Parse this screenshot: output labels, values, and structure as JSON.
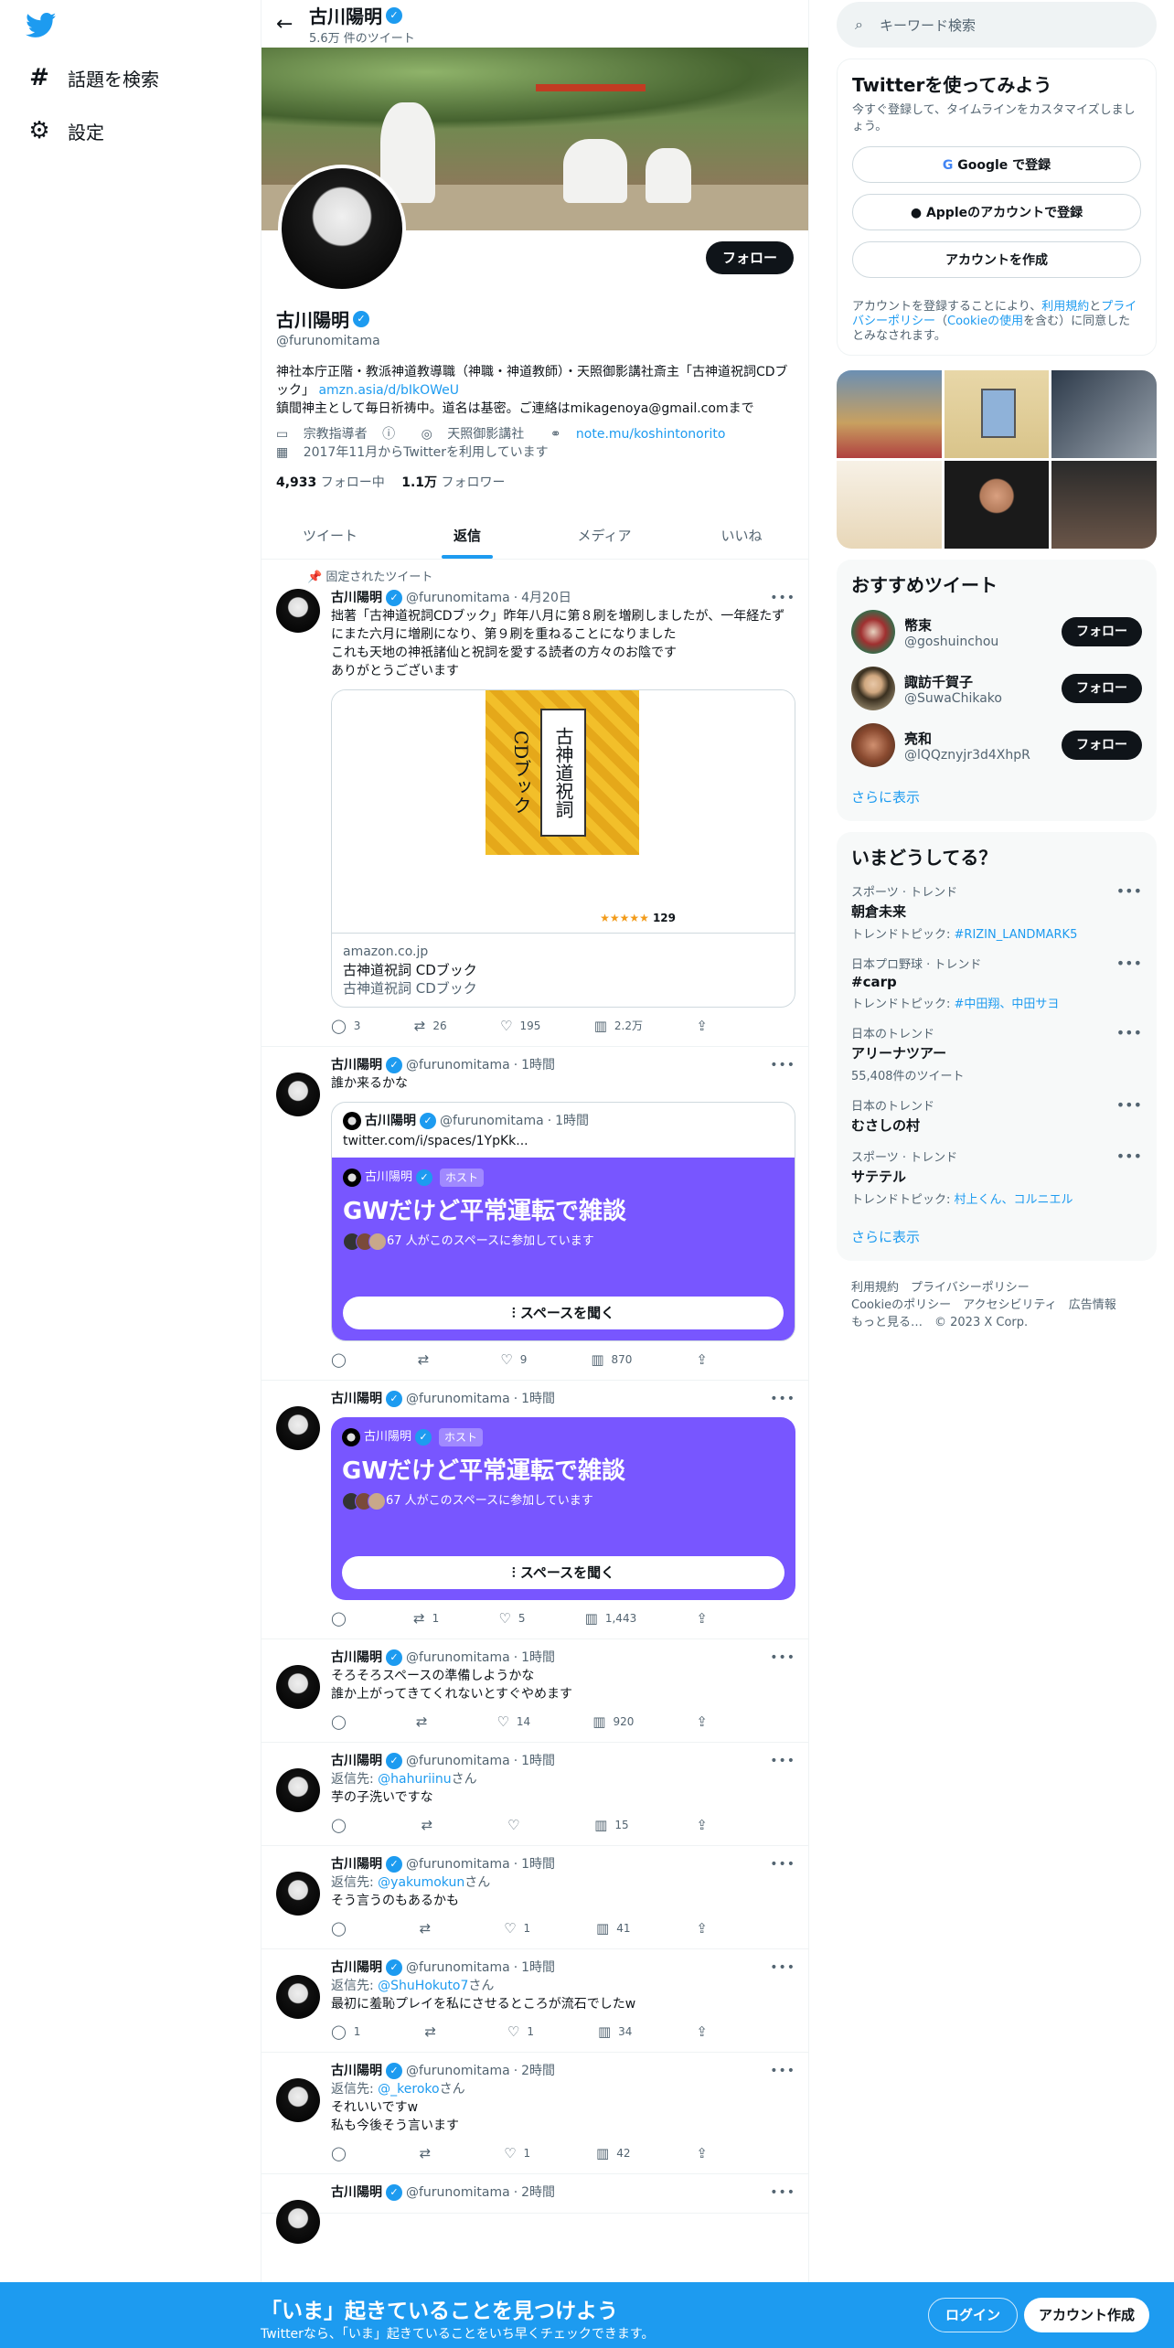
{
  "header": {
    "name": "古川陽明",
    "tweet_count": "5.6万 件のツイート"
  },
  "nav": {
    "explore": "話題を検索",
    "settings": "設定"
  },
  "profile": {
    "name": "古川陽明",
    "handle": "@furunomitama",
    "follow": "フォロー",
    "bio_line1": "神社本庁正階・教派神道教導職（神職・神道教師）・天照御影講社斎主「古神道祝詞CDブック」",
    "bio_link": "amzn.asia/d/bIkOWeU",
    "bio_line2": "鎮間神主として毎日祈祷中。道名は基密。ご連絡はmikagenoya@gmail.comまで",
    "category": "宗教指導者",
    "location": "天照御影講社",
    "website": "note.mu/koshintonorito",
    "joined": "2017年11月からTwitterを利用しています",
    "following_count": "4,933",
    "following_label": "フォロー中",
    "followers_count": "1.1万",
    "followers_label": "フォロワー"
  },
  "tabs": [
    "ツイート",
    "返信",
    "メディア",
    "いいね"
  ],
  "tweets": {
    "t1": {
      "pinned": "固定されたツイート",
      "name": "古川陽明",
      "handle": "@furunomitama",
      "time": "4月20日",
      "text": "拙著「古神道祝詞CDブック」昨年八月に第８刷を増刷しましたが、一年経たずにまた六月に増刷になり、第９刷を重ねることになりました\nこれも天地の神祇諸仙と祝詞を愛する読者の方々のお陰です\nありがとうございます",
      "book_title": "古神道祝詞 CDブック",
      "book_rating": "129",
      "card_domain": "amazon.co.jp",
      "card_title": "古神道祝詞 CDブック",
      "card_desc": "古神道祝詞 CDブック",
      "reply": "3",
      "rt": "26",
      "like": "195",
      "views": "2.2万"
    },
    "t2": {
      "name": "古川陽明",
      "handle": "@furunomitama",
      "time": "1時間",
      "text": "誰か来るかな",
      "q_name": "古川陽明",
      "q_handle": "@furunomitama",
      "q_time": "1時間",
      "q_text": "twitter.com/i/spaces/1YpKk...",
      "host_name": "古川陽明",
      "host_tag": "ホスト",
      "space_title": "GWだけど平常運転で雑談",
      "space_join": "67 人がこのスペースに参加しています",
      "space_btn": "スペースを聞く",
      "reply": "",
      "rt": "",
      "like": "9",
      "views": "870"
    },
    "t3": {
      "name": "古川陽明",
      "handle": "@furunomitama",
      "time": "1時間",
      "host_name": "古川陽明",
      "host_tag": "ホスト",
      "space_title": "GWだけど平常運転で雑談",
      "space_join": "67 人がこのスペースに参加しています",
      "space_btn": "スペースを聞く",
      "reply": "",
      "rt": "1",
      "like": "5",
      "views": "1,443"
    },
    "t4": {
      "name": "古川陽明",
      "handle": "@furunomitama",
      "time": "1時間",
      "text": "そろそろスペースの準備しようかな\n誰か上がってきてくれないとすぐやめます",
      "reply": "",
      "rt": "",
      "like": "14",
      "views": "920"
    },
    "t5": {
      "name": "古川陽明",
      "handle": "@furunomitama",
      "time": "1時間",
      "reply_to": "返信先: ",
      "reply_user": "@hahuriinu",
      "san": "さん",
      "text": "芋の子洗いですな",
      "reply": "",
      "rt": "",
      "like": "",
      "views": "15"
    },
    "t6": {
      "name": "古川陽明",
      "handle": "@furunomitama",
      "time": "1時間",
      "reply_to": "返信先: ",
      "reply_user": "@yakumokun",
      "san": "さん",
      "text": "そう言うのもあるかも",
      "reply": "",
      "rt": "",
      "like": "1",
      "views": "41"
    },
    "t7": {
      "name": "古川陽明",
      "handle": "@furunomitama",
      "time": "1時間",
      "reply_to": "返信先: ",
      "reply_user": "@ShuHokuto7",
      "san": "さん",
      "text": "最初に羞恥プレイを私にさせるところが流石でしたw",
      "reply": "1",
      "rt": "",
      "like": "1",
      "views": "34"
    },
    "t8": {
      "name": "古川陽明",
      "handle": "@furunomitama",
      "time": "2時間",
      "reply_to": "返信先: ",
      "reply_user": "@_keroko",
      "san": "さん",
      "text": "それいいですw\n私も今後そう言います",
      "reply": "",
      "rt": "",
      "like": "1",
      "views": "42"
    },
    "t9": {
      "name": "古川陽明",
      "handle": "@furunomitama",
      "time": "2時間"
    }
  },
  "right": {
    "search_placeholder": "キーワード検索",
    "signup": {
      "title": "Twitterを使ってみよう",
      "sub": "今すぐ登録して、タイムラインをカスタマイズしましょう。",
      "google": "Google で登録",
      "apple": "Appleのアカウントで登録",
      "create": "アカウントを作成",
      "legal1": "アカウントを登録することにより、",
      "terms": "利用規約",
      "and": "と",
      "privacy": "プライバシーポリシー",
      "paren": "（",
      "cookie": "Cookieの使用",
      "legal2": "を含む）に同意したとみなされます。"
    },
    "rec": {
      "title": "おすすめツイート",
      "users": [
        {
          "name": "幣束",
          "handle": "@goshuinchou",
          "btn": "フォロー"
        },
        {
          "name": "諏訪千賀子",
          "handle": "@SuwaChikako",
          "btn": "フォロー"
        },
        {
          "name": "亮和",
          "handle": "@lQQznyjr3d4XhpR",
          "btn": "フォロー"
        }
      ],
      "more": "さらに表示"
    },
    "trends": {
      "title": "いまどうしてる？",
      "items": [
        {
          "cat": "スポーツ · トレンド",
          "title": "朝倉未来",
          "sub_label": "トレンドトピック: ",
          "sub_link": "#RIZIN_LANDMARK5"
        },
        {
          "cat": "日本プロ野球 · トレンド",
          "title": "#carp",
          "sub_label": "トレンドトピック: ",
          "sub_link": "#中田翔、中田サヨ"
        },
        {
          "cat": "日本のトレンド",
          "title": "アリーナツアー",
          "sub_label": "55,408件のツイート",
          "sub_link": ""
        },
        {
          "cat": "日本のトレンド",
          "title": "むさしの村",
          "sub_label": "",
          "sub_link": ""
        },
        {
          "cat": "スポーツ · トレンド",
          "title": "サテテル",
          "sub_label": "トレンドトピック: ",
          "sub_link": "村上くん、コルニエル"
        }
      ],
      "more": "さらに表示"
    },
    "footer": {
      "l1": "利用規約　プライバシーポリシー",
      "l2": "Cookieのポリシー　アクセシビリティ　広告情報",
      "l3": "もっと見る…　© 2023 X Corp."
    }
  },
  "bottom": {
    "title": "「いま」起きていることを見つけよう",
    "sub": "Twitterなら、「いま」起きていることをいち早くチェックできます。",
    "login": "ログイン",
    "signup": "アカウント作成"
  },
  "colors": {
    "accent": "#1d9bf0",
    "space": "#7856ff"
  }
}
